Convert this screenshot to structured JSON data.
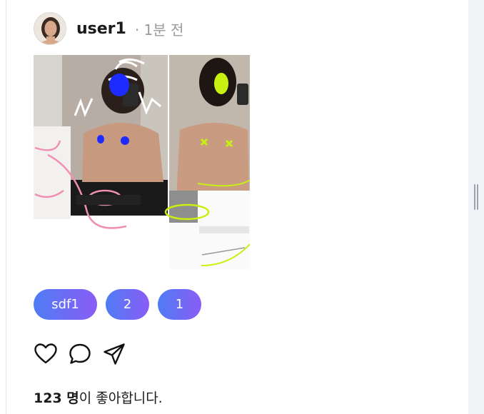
{
  "post": {
    "username": "user1",
    "timestamp": "· 1분 전",
    "tags": [
      "sdf1",
      "2",
      "1"
    ],
    "likes": {
      "count": "123 명",
      "suffix": "이 좋아합니다."
    }
  },
  "colors": {
    "tag_gradient_start": "#4f7cf5",
    "tag_gradient_end": "#8a5cf6",
    "scribble_blue": "#1e2bff",
    "scribble_lime": "#c8f010",
    "scribble_pink": "#f090b0"
  },
  "icons": {
    "like": "heart-icon",
    "comment": "comment-icon",
    "share": "send-icon"
  }
}
